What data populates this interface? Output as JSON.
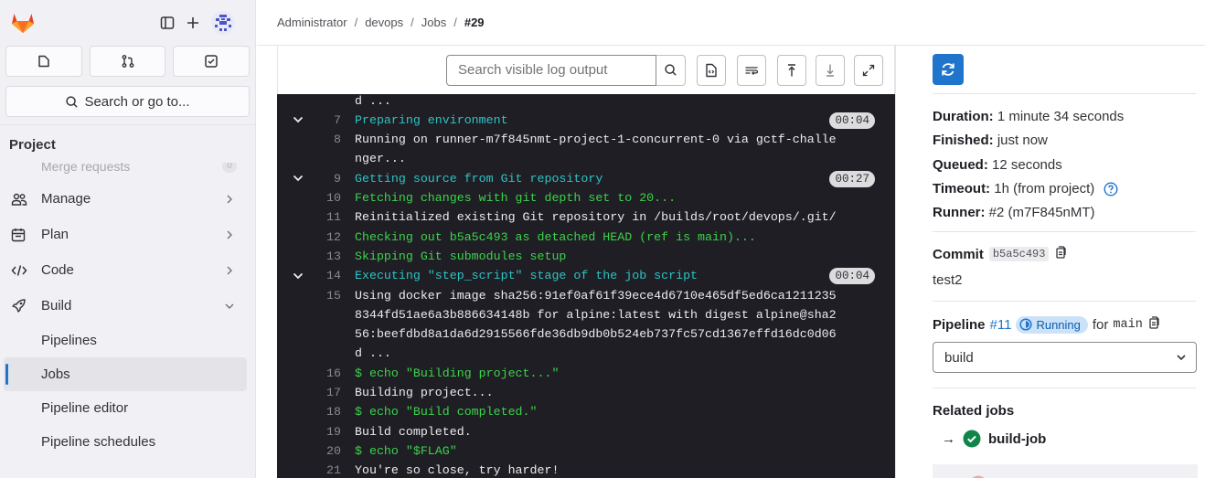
{
  "sidebar": {
    "quick_actions": [
      "issues-icon",
      "merge-request-icon",
      "todo-icon"
    ],
    "search_label": "Search or go to...",
    "section_title": "Project",
    "faded_item": "Merge requests",
    "faded_count": "0",
    "nav": [
      {
        "label": "Manage",
        "icon": "users-icon"
      },
      {
        "label": "Plan",
        "icon": "calendar-icon"
      },
      {
        "label": "Code",
        "icon": "code-icon"
      },
      {
        "label": "Build",
        "icon": "rocket-icon"
      }
    ],
    "build_sub": [
      "Pipelines",
      "Jobs",
      "Pipeline editor",
      "Pipeline schedules"
    ],
    "active_sub": "Jobs"
  },
  "breadcrumb": {
    "items": [
      "Administrator",
      "devops",
      "Jobs"
    ],
    "current": "#29"
  },
  "log_toolbar": {
    "search_placeholder": "Search visible log output"
  },
  "log": {
    "lines": [
      {
        "n": "",
        "text": "d ...",
        "color": "white"
      },
      {
        "n": "7",
        "text": "Preparing environment",
        "color": "cyan",
        "section": true,
        "duration": "00:04"
      },
      {
        "n": "8",
        "text": "Running on runner-m7f845nmt-project-1-concurrent-0 via gctf-challe",
        "color": "white"
      },
      {
        "n": "",
        "text": "nger...",
        "color": "white"
      },
      {
        "n": "9",
        "text": "Getting source from Git repository",
        "color": "cyan",
        "section": true,
        "duration": "00:27"
      },
      {
        "n": "10",
        "text": "Fetching changes with git depth set to 20...",
        "color": "green"
      },
      {
        "n": "11",
        "text": "Reinitialized existing Git repository in /builds/root/devops/.git/",
        "color": "white"
      },
      {
        "n": "12",
        "text": "Checking out b5a5c493 as detached HEAD (ref is main)...",
        "color": "green"
      },
      {
        "n": "13",
        "text": "Skipping Git submodules setup",
        "color": "green"
      },
      {
        "n": "14",
        "text": "Executing \"step_script\" stage of the job script",
        "color": "cyan",
        "section": true,
        "duration": "00:04"
      },
      {
        "n": "15",
        "text": "Using docker image sha256:91ef0af61f39ece4d6710e465df5ed6ca1211235",
        "color": "white"
      },
      {
        "n": "",
        "text": "8344fd51ae6a3b886634148b for alpine:latest with digest alpine@sha2",
        "color": "white"
      },
      {
        "n": "",
        "text": "56:beefdbd8a1da6d2915566fde36db9db0b524eb737fc57cd1367effd16dc0d06",
        "color": "white"
      },
      {
        "n": "",
        "text": "d ...",
        "color": "white"
      },
      {
        "n": "16",
        "text": "$ echo \"Building project...\"",
        "color": "green"
      },
      {
        "n": "17",
        "text": "Building project...",
        "color": "white"
      },
      {
        "n": "18",
        "text": "$ echo \"Build completed.\"",
        "color": "green"
      },
      {
        "n": "19",
        "text": "Build completed.",
        "color": "white"
      },
      {
        "n": "20",
        "text": "$ echo \"$FLAG\"",
        "color": "green"
      },
      {
        "n": "21",
        "text": "You're so close, try harder!",
        "color": "white"
      }
    ]
  },
  "details": {
    "duration_label": "Duration:",
    "duration": "1 minute 34 seconds",
    "finished_label": "Finished:",
    "finished": "just now",
    "queued_label": "Queued:",
    "queued": "12 seconds",
    "timeout_label": "Timeout:",
    "timeout": "1h (from project)",
    "runner_label": "Runner:",
    "runner": "#2 (m7F845nMT)"
  },
  "commit": {
    "label": "Commit",
    "sha": "b5a5c493",
    "message": "test2"
  },
  "pipeline": {
    "label": "Pipeline",
    "id": "#11",
    "status": "Running",
    "for_text": "for",
    "ref": "main",
    "stage": "build"
  },
  "related": {
    "title": "Related jobs",
    "arrow": "→",
    "job": "build-job"
  },
  "colors": {
    "log_bg": "#1f1e24",
    "log_cyan": "#2cc4c4",
    "log_green": "#3bd34b",
    "accent": "#1f75cb",
    "success": "#108548"
  }
}
